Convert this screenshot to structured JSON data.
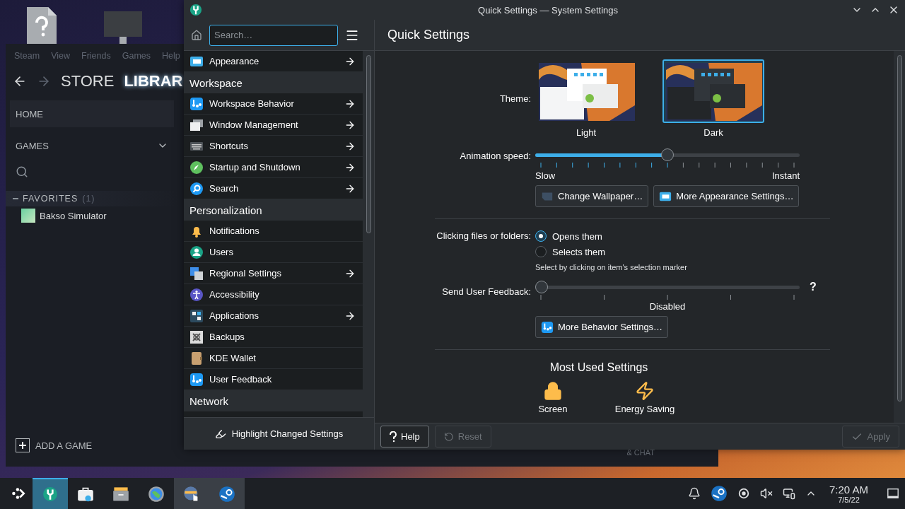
{
  "steam": {
    "menu": [
      "Steam",
      "View",
      "Friends",
      "Games",
      "Help"
    ],
    "store": "STORE",
    "library": "LIBRAR",
    "home": "HOME",
    "games_filter": "GAMES",
    "collections": [
      {
        "name": "FAVORITES",
        "count": "(1)",
        "expanded": true,
        "games": [
          "Bakso Simulator"
        ]
      }
    ],
    "add_game": "ADD A GAME",
    "chat": "& CHAT"
  },
  "window": {
    "title": "Quick Settings — System Settings"
  },
  "sidebar": {
    "search": {
      "placeholder": "Search…"
    },
    "items": [
      {
        "kind": "item",
        "label": "Appearance",
        "arrow": true
      },
      {
        "kind": "header",
        "label": "Workspace"
      },
      {
        "kind": "item",
        "label": "Workspace Behavior",
        "arrow": true
      },
      {
        "kind": "item",
        "label": "Window Management",
        "arrow": true
      },
      {
        "kind": "item",
        "label": "Shortcuts",
        "arrow": true
      },
      {
        "kind": "item",
        "label": "Startup and Shutdown",
        "arrow": true
      },
      {
        "kind": "item",
        "label": "Search",
        "arrow": true
      },
      {
        "kind": "header",
        "label": "Personalization"
      },
      {
        "kind": "item",
        "label": "Notifications",
        "arrow": false
      },
      {
        "kind": "item",
        "label": "Users",
        "arrow": false
      },
      {
        "kind": "item",
        "label": "Regional Settings",
        "arrow": true
      },
      {
        "kind": "item",
        "label": "Accessibility",
        "arrow": false
      },
      {
        "kind": "item",
        "label": "Applications",
        "arrow": true
      },
      {
        "kind": "item",
        "label": "Backups",
        "arrow": false
      },
      {
        "kind": "item",
        "label": "KDE Wallet",
        "arrow": false
      },
      {
        "kind": "item",
        "label": "User Feedback",
        "arrow": false
      },
      {
        "kind": "header",
        "label": "Network"
      }
    ],
    "footer": "Highlight Changed Settings"
  },
  "page": {
    "title": "Quick Settings",
    "theme": {
      "label": "Theme:",
      "options": [
        {
          "name": "Light",
          "selected": false
        },
        {
          "name": "Dark",
          "selected": true
        }
      ]
    },
    "animation": {
      "label": "Animation speed:",
      "level": 0.5,
      "min_label": "Slow",
      "max_label": "Instant"
    },
    "appearance_buttons": [
      "Change Wallpaper…",
      "More Appearance Settings…"
    ],
    "clicking": {
      "label": "Clicking files or folders:",
      "options": [
        {
          "label": "Opens them",
          "selected": true
        },
        {
          "label": "Selects them",
          "selected": false
        }
      ],
      "hint": "Select by clicking on item's selection marker"
    },
    "feedback": {
      "label": "Send User Feedback:",
      "level": 0,
      "reading": "Disabled",
      "help": "?"
    },
    "behavior_button": "More Behavior Settings…",
    "most_used": {
      "title": "Most Used Settings",
      "items": [
        "Screen",
        "Energy Saving"
      ]
    }
  },
  "footer_buttons": [
    {
      "label": "Help",
      "disabled": false
    },
    {
      "label": "Reset",
      "disabled": true
    },
    {
      "label": "Apply",
      "disabled": true
    }
  ],
  "taskbar": {
    "tasks": [
      {
        "selected": true,
        "open": true
      },
      {
        "selected": false,
        "open": false
      },
      {
        "selected": false,
        "open": false
      },
      {
        "selected": false,
        "open": false
      },
      {
        "selected": false,
        "open": true
      },
      {
        "selected": false,
        "open": true
      }
    ],
    "clock": {
      "time": "7:20 AM",
      "date": "7/5/22"
    }
  }
}
